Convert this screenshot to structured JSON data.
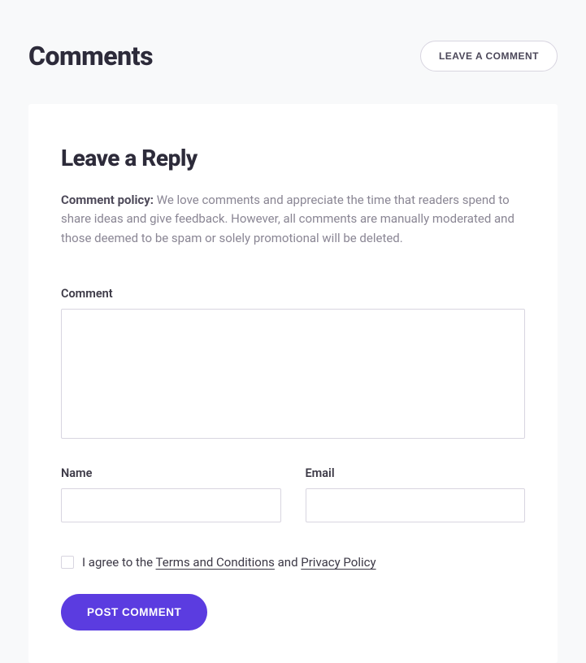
{
  "header": {
    "title": "Comments",
    "button_label": "LEAVE A COMMENT"
  },
  "form": {
    "title": "Leave a Reply",
    "policy": {
      "label": "Comment policy:",
      "text": " We love comments and appreciate the time that readers spend to share ideas and give feedback. However, all comments are manually moderated and those deemed to be spam or solely promotional will be deleted."
    },
    "fields": {
      "comment": {
        "label": "Comment",
        "value": ""
      },
      "name": {
        "label": "Name",
        "value": ""
      },
      "email": {
        "label": "Email",
        "value": ""
      }
    },
    "consent": {
      "prefix": "I agree to the ",
      "terms_link": "Terms and Conditions",
      "middle": " and ",
      "privacy_link": "Privacy Policy",
      "checked": false
    },
    "submit_label": "POST COMMENT"
  }
}
